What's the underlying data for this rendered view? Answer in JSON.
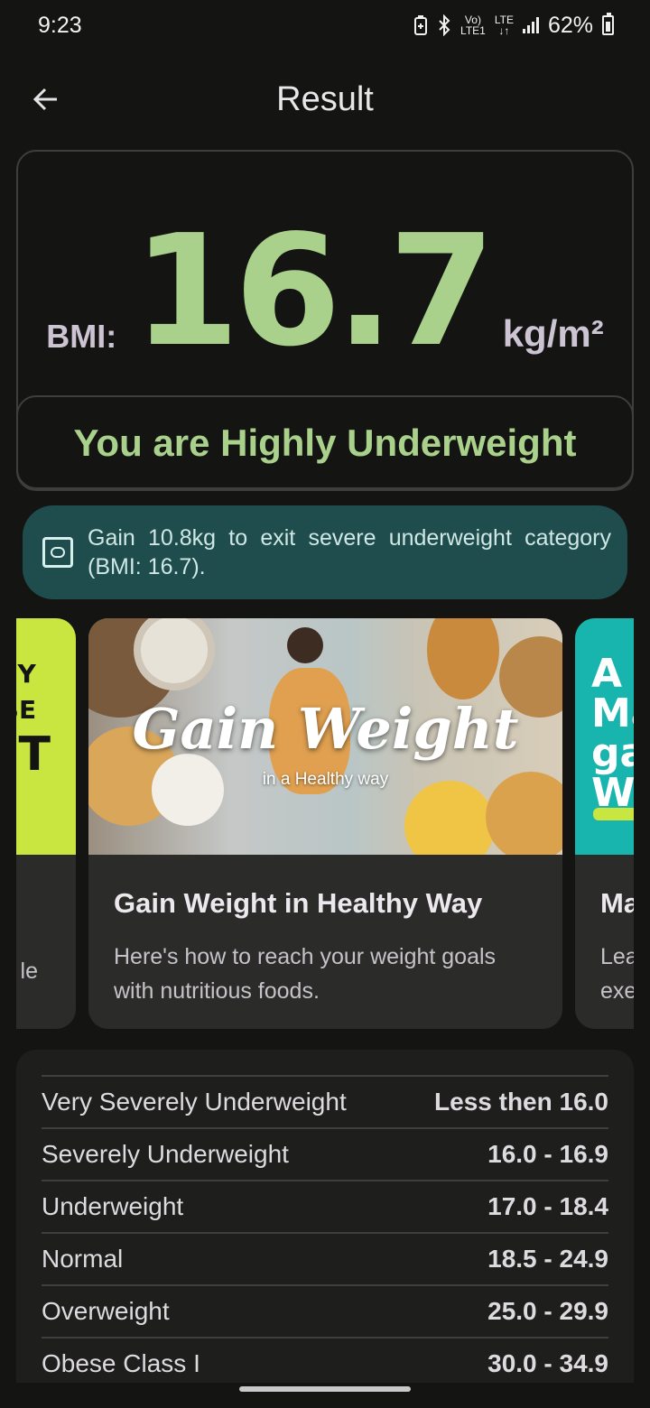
{
  "status_bar": {
    "time": "9:23",
    "volte": "Vo)\nLTE1",
    "lte": "LTE\n↓↑",
    "battery": "62%"
  },
  "app_bar": {
    "title": "Result"
  },
  "bmi": {
    "label": "BMI:",
    "value": "16.7",
    "unit": "kg/m²",
    "status": "You are Highly Underweight"
  },
  "tip": {
    "text": "Gain 10.8kg to exit severe underweight category (BMI: 16.7)."
  },
  "carousel": {
    "left_card": {
      "image_lines": [
        "THY",
        "OSE",
        "HT"
      ],
      "desc": "le"
    },
    "main_card": {
      "image_title": "Gain Weight",
      "image_subtitle": "in a Healthy way",
      "title": "Gain Weight in Healthy Way",
      "desc": "Here's how to reach your weight goals with nutritious foods."
    },
    "right_card": {
      "image_lines": [
        "A C",
        "Ma",
        "ga",
        "W"
      ],
      "title": "Ma",
      "desc_line1": "Lea",
      "desc_line2": "exe"
    }
  },
  "bmi_table": {
    "rows": [
      {
        "category": "Very Severely Underweight",
        "range": "Less then 16.0"
      },
      {
        "category": "Severely Underweight",
        "range": "16.0 - 16.9"
      },
      {
        "category": "Underweight",
        "range": "17.0 - 18.4"
      },
      {
        "category": "Normal",
        "range": "18.5 - 24.9"
      },
      {
        "category": "Overweight",
        "range": "25.0 - 29.9"
      },
      {
        "category": "Obese Class I",
        "range": "30.0 - 34.9"
      }
    ]
  },
  "colors": {
    "background": "#141512",
    "accent_green": "#a9d18b",
    "tip_background": "#1f4c4c",
    "card_background": "#2b2c29"
  }
}
